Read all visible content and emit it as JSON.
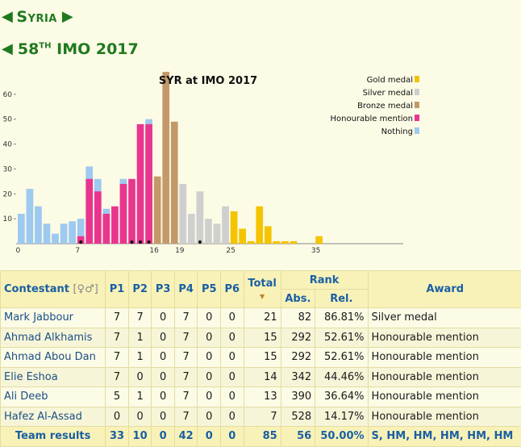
{
  "nav": {
    "country": "Syria",
    "olympiad_ordinal": "58",
    "olympiad_suffix": "TH",
    "olympiad_name": "IMO 2017"
  },
  "chart_data": {
    "type": "bar",
    "title": "SYR at IMO 2017",
    "xlabel": "",
    "ylabel": "",
    "ylim": [
      0,
      70
    ],
    "yticks": [
      10,
      20,
      30,
      40,
      50,
      60
    ],
    "xtick_labels": [
      "0",
      "7",
      "16",
      "19",
      "25",
      "35"
    ],
    "xtick_positions": [
      0,
      7,
      16,
      19,
      25,
      35
    ],
    "legend_placement": "top-right",
    "legend": [
      {
        "name": "Gold medal",
        "color": "#f5c400"
      },
      {
        "name": "Silver medal",
        "color": "#cfcfcf"
      },
      {
        "name": "Bronze medal",
        "color": "#c3996a"
      },
      {
        "name": "Honourable mention",
        "color": "#e8368f"
      },
      {
        "name": "Nothing",
        "color": "#9ec9f0"
      }
    ],
    "bars": [
      {
        "x": 0,
        "value": 12,
        "cat": "Nothing"
      },
      {
        "x": 1,
        "value": 22,
        "cat": "Nothing"
      },
      {
        "x": 2,
        "value": 15,
        "cat": "Nothing"
      },
      {
        "x": 3,
        "value": 8,
        "cat": "Nothing"
      },
      {
        "x": 4,
        "value": 4,
        "cat": "Nothing"
      },
      {
        "x": 5,
        "value": 8,
        "cat": "Nothing"
      },
      {
        "x": 6,
        "value": 9,
        "cat": "Nothing"
      },
      {
        "x": 7,
        "value": 10,
        "hm": 3,
        "cat": "Mixed"
      },
      {
        "x": 8,
        "value": 31,
        "hm": 26,
        "cat": "Mixed"
      },
      {
        "x": 9,
        "value": 26,
        "hm": 21,
        "cat": "Mixed"
      },
      {
        "x": 10,
        "value": 14,
        "hm": 12,
        "cat": "Mixed"
      },
      {
        "x": 11,
        "value": 15,
        "cat": "Honourable mention"
      },
      {
        "x": 12,
        "value": 26,
        "hm": 24,
        "cat": "Mixed"
      },
      {
        "x": 13,
        "value": 26,
        "cat": "Honourable mention"
      },
      {
        "x": 14,
        "value": 48,
        "cat": "Honourable mention"
      },
      {
        "x": 15,
        "value": 50,
        "hm": 48,
        "cat": "Mixed"
      },
      {
        "x": 16,
        "value": 27,
        "cat": "Bronze medal"
      },
      {
        "x": 17,
        "value": 69,
        "cat": "Bronze medal"
      },
      {
        "x": 18,
        "value": 49,
        "cat": "Bronze medal"
      },
      {
        "x": 19,
        "value": 24,
        "cat": "Silver medal"
      },
      {
        "x": 20,
        "value": 12,
        "cat": "Silver medal"
      },
      {
        "x": 21,
        "value": 21,
        "cat": "Silver medal"
      },
      {
        "x": 22,
        "value": 10,
        "cat": "Silver medal"
      },
      {
        "x": 23,
        "value": 8,
        "cat": "Silver medal"
      },
      {
        "x": 24,
        "value": 15,
        "cat": "Silver medal"
      },
      {
        "x": 25,
        "value": 13,
        "cat": "Gold medal"
      },
      {
        "x": 26,
        "value": 6,
        "cat": "Gold medal"
      },
      {
        "x": 27,
        "value": 1,
        "cat": "Gold medal"
      },
      {
        "x": 28,
        "value": 15,
        "cat": "Gold medal"
      },
      {
        "x": 29,
        "value": 7,
        "cat": "Gold medal"
      },
      {
        "x": 30,
        "value": 1,
        "cat": "Gold medal"
      },
      {
        "x": 31,
        "value": 1,
        "cat": "Gold medal"
      },
      {
        "x": 32,
        "value": 1,
        "cat": "Gold medal"
      },
      {
        "x": 35,
        "value": 3,
        "cat": "Gold medal"
      }
    ],
    "team_markers": [
      7,
      13,
      14,
      15,
      21
    ]
  },
  "table": {
    "headers": {
      "contestant": "Contestant",
      "gender_symbols": "[♀♂]",
      "p1": "P1",
      "p2": "P2",
      "p3": "P3",
      "p4": "P4",
      "p5": "P5",
      "p6": "P6",
      "total": "Total",
      "rank": "Rank",
      "abs": "Abs.",
      "rel": "Rel.",
      "award": "Award"
    },
    "rows": [
      {
        "name": "Mark Jabbour",
        "p1": "7",
        "p2": "7",
        "p3": "0",
        "p4": "7",
        "p5": "0",
        "p6": "0",
        "total": "21",
        "abs": "82",
        "rel": "86.81%",
        "award": "Silver medal"
      },
      {
        "name": "Ahmad Alkhamis",
        "p1": "7",
        "p2": "1",
        "p3": "0",
        "p4": "7",
        "p5": "0",
        "p6": "0",
        "total": "15",
        "abs": "292",
        "rel": "52.61%",
        "award": "Honourable mention"
      },
      {
        "name": "Ahmad Abou Dan",
        "p1": "7",
        "p2": "1",
        "p3": "0",
        "p4": "7",
        "p5": "0",
        "p6": "0",
        "total": "15",
        "abs": "292",
        "rel": "52.61%",
        "award": "Honourable mention"
      },
      {
        "name": "Elie Eshoa",
        "p1": "7",
        "p2": "0",
        "p3": "0",
        "p4": "7",
        "p5": "0",
        "p6": "0",
        "total": "14",
        "abs": "342",
        "rel": "44.46%",
        "award": "Honourable mention"
      },
      {
        "name": "Ali Deeb",
        "p1": "5",
        "p2": "1",
        "p3": "0",
        "p4": "7",
        "p5": "0",
        "p6": "0",
        "total": "13",
        "abs": "390",
        "rel": "36.64%",
        "award": "Honourable mention"
      },
      {
        "name": "Hafez Al-Assad",
        "p1": "0",
        "p2": "0",
        "p3": "0",
        "p4": "7",
        "p5": "0",
        "p6": "0",
        "total": "7",
        "abs": "528",
        "rel": "14.17%",
        "award": "Honourable mention"
      }
    ],
    "team": {
      "label": "Team results",
      "p1": "33",
      "p2": "10",
      "p3": "0",
      "p4": "42",
      "p5": "0",
      "p6": "0",
      "total": "85",
      "abs": "56",
      "rel": "50.00%",
      "award": "S, HM, HM, HM, HM, HM"
    }
  }
}
